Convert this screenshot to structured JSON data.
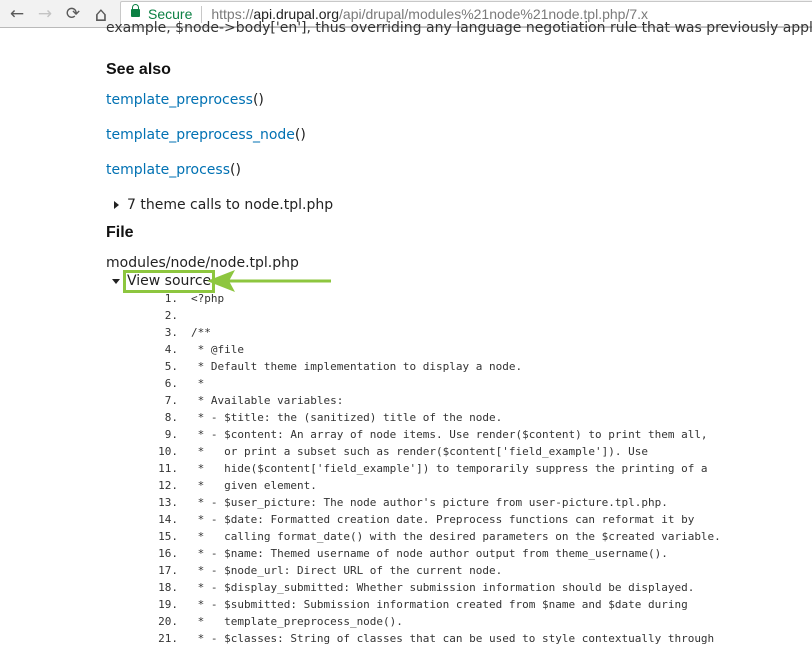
{
  "browser": {
    "back_label": "←",
    "forward_label": "→",
    "reload_label": "⟳",
    "home_label": "⌂",
    "security_label": "Secure",
    "url_scheme": "https://",
    "url_host": "api.drupal.org",
    "url_path": "/api/drupal/modules%21node%21node.tpl.php/7.x",
    "lock_color": "#0b8043"
  },
  "page": {
    "cut_off_text": "example, $node->body['en'], thus overriding any language negotiation rule that was previously applied.",
    "see_also": {
      "heading": "See also",
      "links": [
        {
          "name": "template_preprocess",
          "suffix": "()"
        },
        {
          "name": "template_preprocess_node",
          "suffix": "()"
        },
        {
          "name": "template_process",
          "suffix": "()"
        }
      ]
    },
    "theme_calls_label": "7 theme calls to node.tpl.php",
    "file": {
      "heading": "File",
      "path": "modules/node/node.tpl.php",
      "view_source_label": "View source"
    },
    "link_color": "#0071b3",
    "highlight_color": "#8dc63f"
  },
  "source": {
    "lines": [
      {
        "n": "1.",
        "text": "<?php"
      },
      {
        "n": "2.",
        "text": ""
      },
      {
        "n": "3.",
        "text": "/**"
      },
      {
        "n": "4.",
        "text": " * @file"
      },
      {
        "n": "5.",
        "text": " * Default theme implementation to display a node."
      },
      {
        "n": "6.",
        "text": " *"
      },
      {
        "n": "7.",
        "text": " * Available variables:"
      },
      {
        "n": "8.",
        "text": " * - $title: the (sanitized) title of the node."
      },
      {
        "n": "9.",
        "text": " * - $content: An array of node items. Use render($content) to print them all,"
      },
      {
        "n": "10.",
        "text": " *   or print a subset such as render($content['field_example']). Use"
      },
      {
        "n": "11.",
        "text": " *   hide($content['field_example']) to temporarily suppress the printing of a"
      },
      {
        "n": "12.",
        "text": " *   given element."
      },
      {
        "n": "13.",
        "text": " * - $user_picture: The node author's picture from user-picture.tpl.php."
      },
      {
        "n": "14.",
        "text": " * - $date: Formatted creation date. Preprocess functions can reformat it by"
      },
      {
        "n": "15.",
        "text": " *   calling format_date() with the desired parameters on the $created variable."
      },
      {
        "n": "16.",
        "text": " * - $name: Themed username of node author output from theme_username()."
      },
      {
        "n": "17.",
        "text": " * - $node_url: Direct URL of the current node."
      },
      {
        "n": "18.",
        "text": " * - $display_submitted: Whether submission information should be displayed."
      },
      {
        "n": "19.",
        "text": " * - $submitted: Submission information created from $name and $date during"
      },
      {
        "n": "20.",
        "text": " *   template_preprocess_node()."
      },
      {
        "n": "21.",
        "text": " * - $classes: String of classes that can be used to style contextually through"
      }
    ]
  }
}
